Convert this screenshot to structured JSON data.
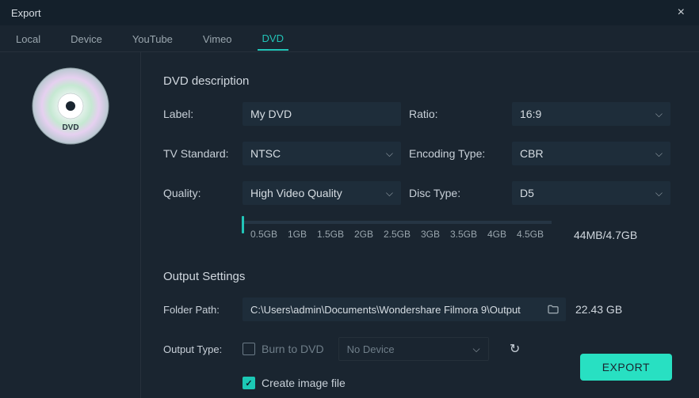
{
  "window": {
    "title": "Export"
  },
  "tabs": {
    "local": "Local",
    "device": "Device",
    "youtube": "YouTube",
    "vimeo": "Vimeo",
    "dvd": "DVD"
  },
  "section": {
    "dvd_title": "DVD description",
    "output_title": "Output Settings"
  },
  "labels": {
    "label": "Label:",
    "ratio": "Ratio:",
    "tvstd": "TV Standard:",
    "encoding": "Encoding Type:",
    "quality": "Quality:",
    "disc": "Disc Type:",
    "folder": "Folder Path:",
    "outtype": "Output Type:"
  },
  "values": {
    "label": "My DVD",
    "ratio": "16:9",
    "tvstd": "NTSC",
    "encoding": "CBR",
    "quality": "High Video Quality",
    "disc": "D5",
    "folder": "C:\\Users\\admin\\Documents\\Wondershare Filmora 9\\Output",
    "freespace": "22.43 GB",
    "size": "44MB/4.7GB",
    "nodevice": "No Device"
  },
  "slider_ticks": [
    "0.5GB",
    "1GB",
    "1.5GB",
    "2GB",
    "2.5GB",
    "3GB",
    "3.5GB",
    "4GB",
    "4.5GB"
  ],
  "checks": {
    "burn": "Burn to DVD",
    "image": "Create image file"
  },
  "buttons": {
    "export": "EXPORT"
  },
  "disc_label": "DVD"
}
